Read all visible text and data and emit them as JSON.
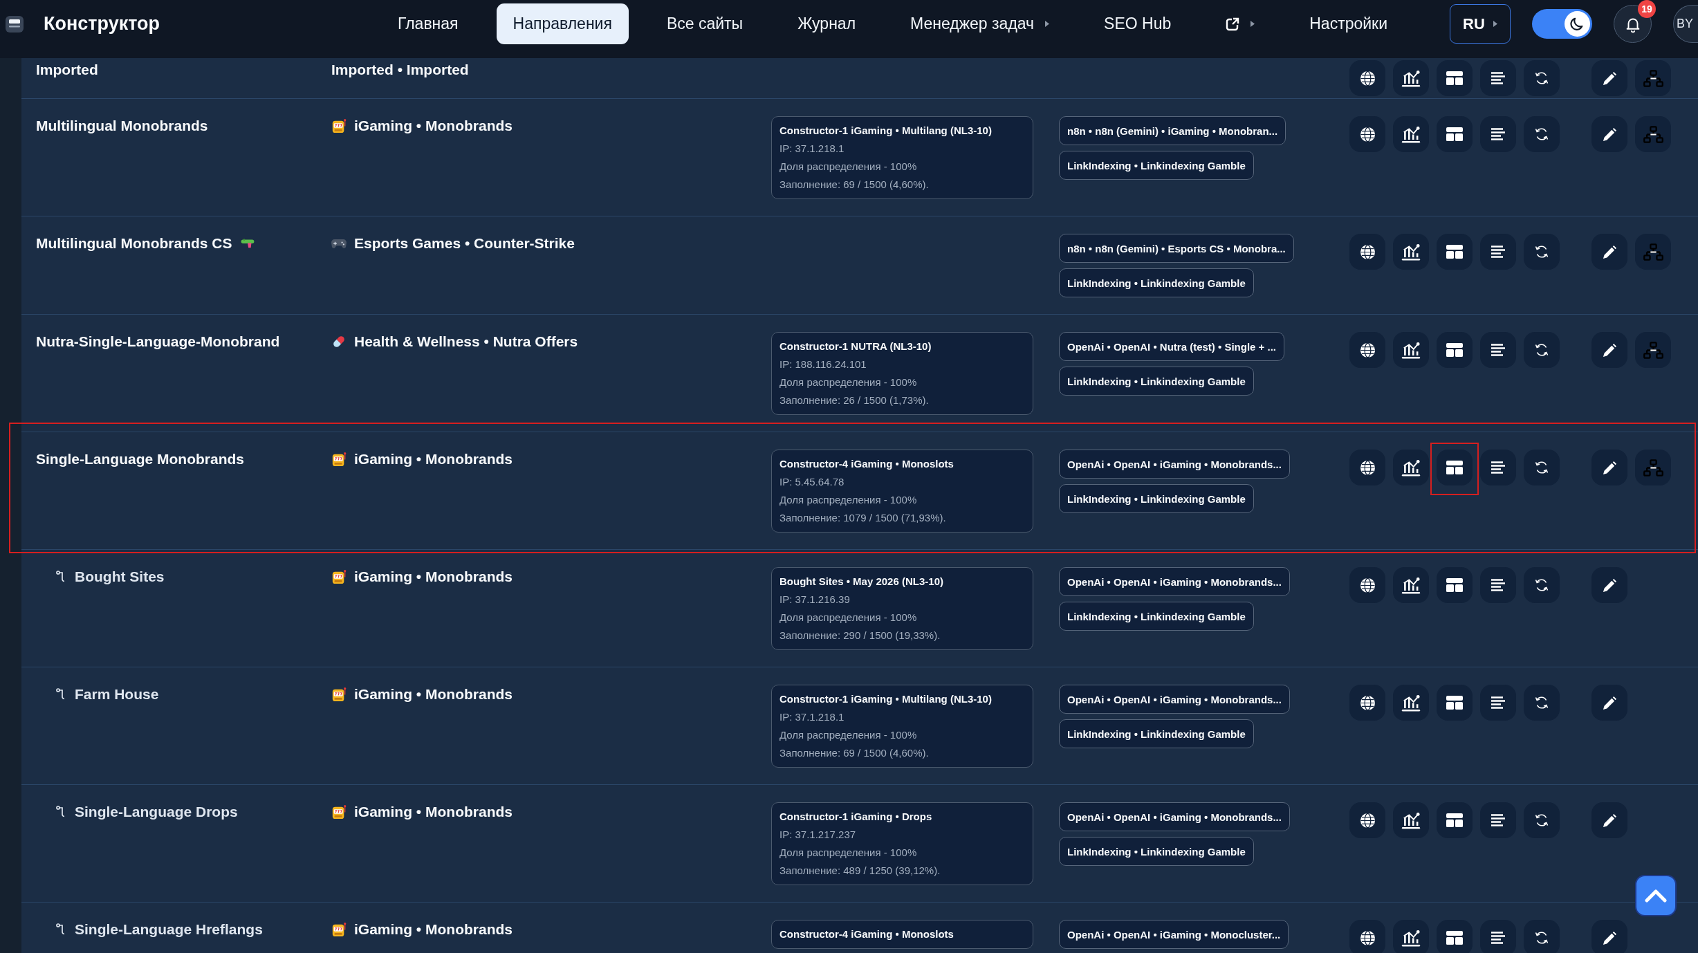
{
  "header": {
    "logo": "Конструктор",
    "nav": [
      {
        "kind": "link",
        "label": "Главная",
        "selected": false,
        "dropdown": false
      },
      {
        "kind": "link",
        "label": "Направления",
        "selected": true,
        "dropdown": false
      },
      {
        "kind": "link",
        "label": "Все сайты",
        "selected": false,
        "dropdown": false
      },
      {
        "kind": "link",
        "label": "Журнал",
        "selected": false,
        "dropdown": false
      },
      {
        "kind": "link",
        "label": "Менеджер задач",
        "selected": false,
        "dropdown": true
      },
      {
        "kind": "link",
        "label": "SEO Hub",
        "selected": false,
        "dropdown": false
      },
      {
        "kind": "icon",
        "selected": false,
        "dropdown": true
      },
      {
        "kind": "link",
        "label": "Настройки",
        "selected": false,
        "dropdown": false
      }
    ],
    "language": {
      "label": "RU",
      "dropdown": true
    },
    "dark_mode": {
      "on": true
    },
    "notifications": {
      "count": "19"
    },
    "avatar": {
      "initials": "BY"
    }
  },
  "rows": [
    {
      "name": "Imported",
      "highlighted": false,
      "layout_highlighted": false,
      "category": {
        "kind": "plain",
        "text": "Imported • Imported"
      }
    },
    {
      "name": "Multilingual Monobrands",
      "highlighted": false,
      "layout_highlighted": false,
      "category": {
        "kind": "slots",
        "text": "iGaming • Monobrands"
      },
      "card": {
        "title": "Constructor-1 iGaming • Multilang (NL3-10)",
        "lines": [
          "IP: 37.1.218.1",
          "Доля распределения - 100%",
          "Заполнение: 69 / 1500 (4,60%)."
        ]
      },
      "tags": [
        "n8n • n8n (Gemini) • iGaming • Monobran...",
        "LinkIndexing • Linkindexing Gamble"
      ]
    },
    {
      "name": "Multilingual Monobrands CS",
      "name_emoji": {
        "kind": "watergun"
      },
      "highlighted": false,
      "layout_highlighted": false,
      "category": {
        "kind": "gamepad",
        "text": "Esports Games • Counter-Strike"
      },
      "tags": [
        "n8n • n8n (Gemini) • Esports CS • Monobra...",
        "LinkIndexing • Linkindexing Gamble"
      ]
    },
    {
      "name": "Nutra-Single-Language-Monobrand",
      "highlighted": false,
      "layout_highlighted": false,
      "category": {
        "kind": "pill",
        "text": "Health & Wellness • Nutra Offers"
      },
      "card": {
        "title": "Constructor-1 NUTRA (NL3-10)",
        "lines": [
          "IP: 188.116.24.101",
          "Доля распределения - 100%",
          "Заполнение: 26 / 1500 (1,73%)."
        ]
      },
      "tags": [
        "OpenAi • OpenAI • Nutra (test) • Single + ...",
        "LinkIndexing • Linkindexing Gamble"
      ]
    },
    {
      "name": "Single-Language Monobrands",
      "highlighted": true,
      "layout_highlighted": true,
      "category": {
        "kind": "slots",
        "text": "iGaming • Monobrands"
      },
      "card": {
        "title": "Constructor-4 iGaming • Monoslots",
        "lines": [
          "IP: 5.45.64.78",
          "Доля распределения - 100%",
          "Заполнение: 1079 / 1500 (71,93%)."
        ]
      },
      "tags": [
        "OpenAi • OpenAI • iGaming • Monobrands...",
        "LinkIndexing • Linkindexing Gamble"
      ],
      "children": [
        {
          "name": "Bought Sites",
          "highlighted": false,
          "layout_highlighted": false,
          "category": {
            "kind": "slots",
            "text": "iGaming • Monobrands"
          },
          "card": {
            "title": "Bought Sites • May 2026 (NL3-10)",
            "lines": [
              "IP: 37.1.216.39",
              "Доля распределения - 100%",
              "Заполнение: 290 / 1500 (19,33%)."
            ]
          },
          "tags": [
            "OpenAi • OpenAI • iGaming • Monobrands...",
            "LinkIndexing • Linkindexing Gamble"
          ]
        },
        {
          "name": "Farm House",
          "highlighted": false,
          "layout_highlighted": false,
          "category": {
            "kind": "slots",
            "text": "iGaming • Monobrands"
          },
          "card": {
            "title": "Constructor-1 iGaming • Multilang (NL3-10)",
            "lines": [
              "IP: 37.1.218.1",
              "Доля распределения - 100%",
              "Заполнение: 69 / 1500 (4,60%)."
            ]
          },
          "tags": [
            "OpenAi • OpenAI • iGaming • Monobrands...",
            "LinkIndexing • Linkindexing Gamble"
          ]
        },
        {
          "name": "Single-Language Drops",
          "highlighted": false,
          "layout_highlighted": false,
          "category": {
            "kind": "slots",
            "text": "iGaming • Monobrands"
          },
          "card": {
            "title": "Constructor-1 iGaming • Drops",
            "lines": [
              "IP: 37.1.217.237",
              "Доля распределения - 100%",
              "Заполнение: 489 / 1250 (39,12%)."
            ]
          },
          "tags": [
            "OpenAi • OpenAI • iGaming • Monobrands...",
            "LinkIndexing • Linkindexing Gamble"
          ]
        },
        {
          "name": "Single-Language Hreflangs",
          "highlighted": false,
          "layout_highlighted": false,
          "category": {
            "kind": "slots",
            "text": "iGaming • Monobrands"
          },
          "card": {
            "title": "Constructor-4 iGaming • Monoslots"
          },
          "tags": [
            "OpenAi • OpenAI • iGaming • Monocluster..."
          ]
        }
      ]
    }
  ]
}
